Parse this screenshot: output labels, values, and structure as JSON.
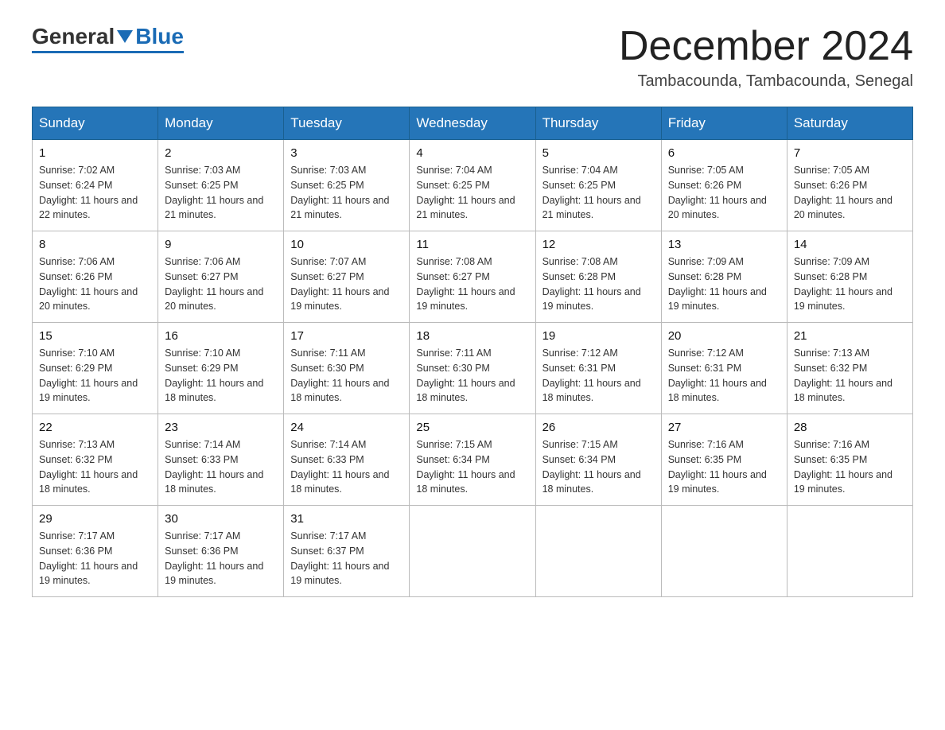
{
  "header": {
    "logo_general": "General",
    "logo_blue": "Blue",
    "month_title": "December 2024",
    "location": "Tambacounda, Tambacounda, Senegal"
  },
  "days_of_week": [
    "Sunday",
    "Monday",
    "Tuesday",
    "Wednesday",
    "Thursday",
    "Friday",
    "Saturday"
  ],
  "weeks": [
    [
      {
        "day": "1",
        "sunrise": "7:02 AM",
        "sunset": "6:24 PM",
        "daylight": "11 hours and 22 minutes."
      },
      {
        "day": "2",
        "sunrise": "7:03 AM",
        "sunset": "6:25 PM",
        "daylight": "11 hours and 21 minutes."
      },
      {
        "day": "3",
        "sunrise": "7:03 AM",
        "sunset": "6:25 PM",
        "daylight": "11 hours and 21 minutes."
      },
      {
        "day": "4",
        "sunrise": "7:04 AM",
        "sunset": "6:25 PM",
        "daylight": "11 hours and 21 minutes."
      },
      {
        "day": "5",
        "sunrise": "7:04 AM",
        "sunset": "6:25 PM",
        "daylight": "11 hours and 21 minutes."
      },
      {
        "day": "6",
        "sunrise": "7:05 AM",
        "sunset": "6:26 PM",
        "daylight": "11 hours and 20 minutes."
      },
      {
        "day": "7",
        "sunrise": "7:05 AM",
        "sunset": "6:26 PM",
        "daylight": "11 hours and 20 minutes."
      }
    ],
    [
      {
        "day": "8",
        "sunrise": "7:06 AM",
        "sunset": "6:26 PM",
        "daylight": "11 hours and 20 minutes."
      },
      {
        "day": "9",
        "sunrise": "7:06 AM",
        "sunset": "6:27 PM",
        "daylight": "11 hours and 20 minutes."
      },
      {
        "day": "10",
        "sunrise": "7:07 AM",
        "sunset": "6:27 PM",
        "daylight": "11 hours and 19 minutes."
      },
      {
        "day": "11",
        "sunrise": "7:08 AM",
        "sunset": "6:27 PM",
        "daylight": "11 hours and 19 minutes."
      },
      {
        "day": "12",
        "sunrise": "7:08 AM",
        "sunset": "6:28 PM",
        "daylight": "11 hours and 19 minutes."
      },
      {
        "day": "13",
        "sunrise": "7:09 AM",
        "sunset": "6:28 PM",
        "daylight": "11 hours and 19 minutes."
      },
      {
        "day": "14",
        "sunrise": "7:09 AM",
        "sunset": "6:28 PM",
        "daylight": "11 hours and 19 minutes."
      }
    ],
    [
      {
        "day": "15",
        "sunrise": "7:10 AM",
        "sunset": "6:29 PM",
        "daylight": "11 hours and 19 minutes."
      },
      {
        "day": "16",
        "sunrise": "7:10 AM",
        "sunset": "6:29 PM",
        "daylight": "11 hours and 18 minutes."
      },
      {
        "day": "17",
        "sunrise": "7:11 AM",
        "sunset": "6:30 PM",
        "daylight": "11 hours and 18 minutes."
      },
      {
        "day": "18",
        "sunrise": "7:11 AM",
        "sunset": "6:30 PM",
        "daylight": "11 hours and 18 minutes."
      },
      {
        "day": "19",
        "sunrise": "7:12 AM",
        "sunset": "6:31 PM",
        "daylight": "11 hours and 18 minutes."
      },
      {
        "day": "20",
        "sunrise": "7:12 AM",
        "sunset": "6:31 PM",
        "daylight": "11 hours and 18 minutes."
      },
      {
        "day": "21",
        "sunrise": "7:13 AM",
        "sunset": "6:32 PM",
        "daylight": "11 hours and 18 minutes."
      }
    ],
    [
      {
        "day": "22",
        "sunrise": "7:13 AM",
        "sunset": "6:32 PM",
        "daylight": "11 hours and 18 minutes."
      },
      {
        "day": "23",
        "sunrise": "7:14 AM",
        "sunset": "6:33 PM",
        "daylight": "11 hours and 18 minutes."
      },
      {
        "day": "24",
        "sunrise": "7:14 AM",
        "sunset": "6:33 PM",
        "daylight": "11 hours and 18 minutes."
      },
      {
        "day": "25",
        "sunrise": "7:15 AM",
        "sunset": "6:34 PM",
        "daylight": "11 hours and 18 minutes."
      },
      {
        "day": "26",
        "sunrise": "7:15 AM",
        "sunset": "6:34 PM",
        "daylight": "11 hours and 18 minutes."
      },
      {
        "day": "27",
        "sunrise": "7:16 AM",
        "sunset": "6:35 PM",
        "daylight": "11 hours and 19 minutes."
      },
      {
        "day": "28",
        "sunrise": "7:16 AM",
        "sunset": "6:35 PM",
        "daylight": "11 hours and 19 minutes."
      }
    ],
    [
      {
        "day": "29",
        "sunrise": "7:17 AM",
        "sunset": "6:36 PM",
        "daylight": "11 hours and 19 minutes."
      },
      {
        "day": "30",
        "sunrise": "7:17 AM",
        "sunset": "6:36 PM",
        "daylight": "11 hours and 19 minutes."
      },
      {
        "day": "31",
        "sunrise": "7:17 AM",
        "sunset": "6:37 PM",
        "daylight": "11 hours and 19 minutes."
      },
      null,
      null,
      null,
      null
    ]
  ],
  "sunrise_label": "Sunrise: ",
  "sunset_label": "Sunset: ",
  "daylight_label": "Daylight: "
}
